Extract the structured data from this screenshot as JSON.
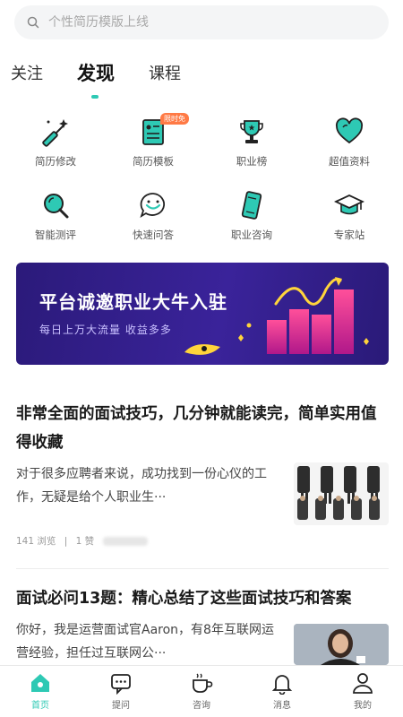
{
  "search": {
    "placeholder": "个性简历模版上线"
  },
  "tabs": [
    {
      "label": "关注"
    },
    {
      "label": "发现"
    },
    {
      "label": "课程"
    }
  ],
  "features": [
    {
      "label": "简历修改",
      "icon": "magic-wand-icon"
    },
    {
      "label": "简历模板",
      "icon": "resume-template-icon",
      "badge": "限时免"
    },
    {
      "label": "职业榜",
      "icon": "trophy-icon"
    },
    {
      "label": "超值资料",
      "icon": "heart-icon"
    },
    {
      "label": "智能测评",
      "icon": "magnifier-icon"
    },
    {
      "label": "快速问答",
      "icon": "chat-icon"
    },
    {
      "label": "职业咨询",
      "icon": "phone-icon"
    },
    {
      "label": "专家站",
      "icon": "graduation-cap-icon"
    }
  ],
  "banner": {
    "title": "平台诚邀职业大牛入驻",
    "subtitle": "每日上万大流量 收益多多"
  },
  "articles": [
    {
      "title": "非常全面的面试技巧，几分钟就能读完，简单实用值得收藏",
      "excerpt": "对于很多应聘者来说，成功找到一份心仪的工作，无疑是给个人职业生···",
      "views": "141 浏览",
      "likes": "1 赞"
    },
    {
      "title": "面试必问13题：精心总结了这些面试技巧和答案",
      "excerpt": "你好，我是运营面试官Aaron，有8年互联网运营经验，担任过互联网公···"
    }
  ],
  "bottom_nav": [
    {
      "label": "首页",
      "icon": "home-icon"
    },
    {
      "label": "提问",
      "icon": "question-bubble-icon"
    },
    {
      "label": "咨询",
      "icon": "coffee-cup-icon"
    },
    {
      "label": "消息",
      "icon": "bell-icon"
    },
    {
      "label": "我的",
      "icon": "person-icon"
    }
  ],
  "colors": {
    "accent": "#2ec9b4",
    "banner_bg": "#2b1a7a",
    "badge": "#ff7a45"
  }
}
